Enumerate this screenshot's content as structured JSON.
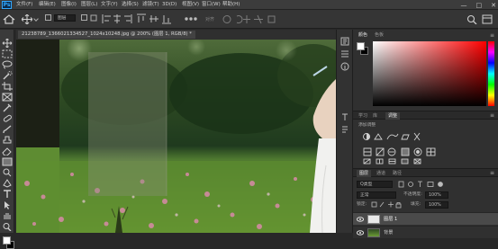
{
  "app": {
    "logo_text": "Ps"
  },
  "menu": [
    "文件(F)",
    "编辑(E)",
    "图像(I)",
    "图层(L)",
    "文字(Y)",
    "选择(S)",
    "滤镜(T)",
    "3D(D)",
    "视图(V)",
    "窗口(W)",
    "帮助(H)"
  ],
  "options_bar": {
    "auto_select_value": "图层",
    "align_label": "对齐"
  },
  "document": {
    "tab_label": "21238789_1366021334527_1024x10248.jpg @ 200% (图层 1, RGB/8) *"
  },
  "color_panel": {
    "tabs": [
      "颜色",
      "色板"
    ],
    "active_tab": 0,
    "hue_color": "#ff0000"
  },
  "adjust_panel": {
    "tabs": [
      "学习",
      "库",
      "调整"
    ],
    "active_tab": 2,
    "heading": "添加调整"
  },
  "layers_panel": {
    "tabs": [
      "图层",
      "通道",
      "路径"
    ],
    "active_tab": 0,
    "kind_filter": "Q类型",
    "blend_mode": "正常",
    "opacity_label": "不透明度:",
    "opacity_value": "100%",
    "lock_label": "锁定:",
    "fill_label": "填充:",
    "fill_value": "100%",
    "layers": [
      {
        "name": "图层 1",
        "selected": true
      },
      {
        "name": "背景",
        "selected": false
      }
    ]
  },
  "window_controls": [
    "—",
    "□",
    "✕"
  ]
}
